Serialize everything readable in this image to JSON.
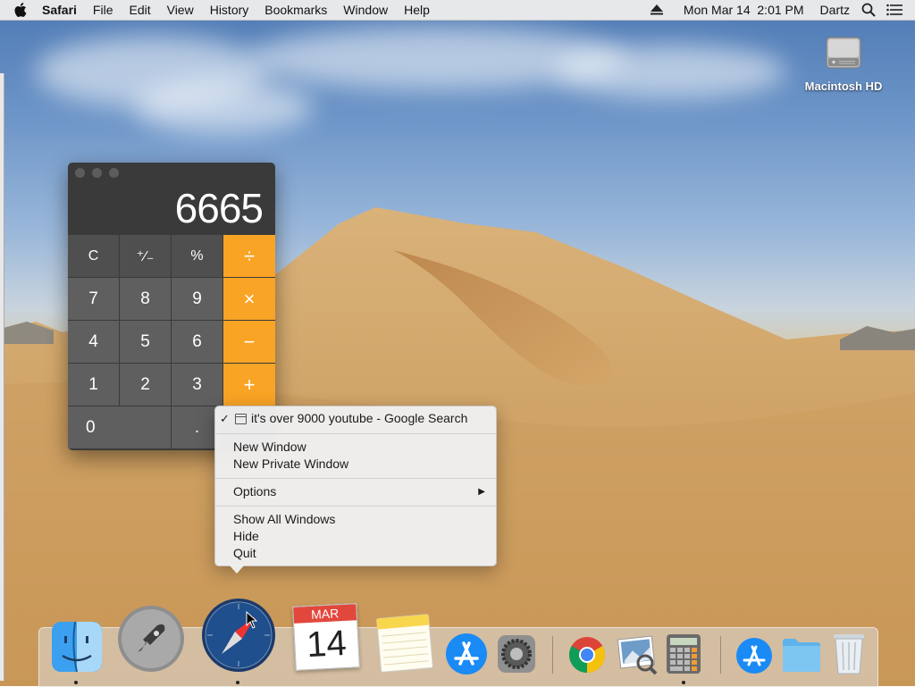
{
  "menubar": {
    "app_name": "Safari",
    "items": [
      "File",
      "Edit",
      "View",
      "History",
      "Bookmarks",
      "Window",
      "Help"
    ],
    "datetime": "Mon Mar 14  2:01 PM",
    "user": "Dartz",
    "icons": [
      "apple-icon",
      "eject-icon",
      "search-icon",
      "list-icon"
    ]
  },
  "desktop": {
    "drive_label": "Macintosh HD"
  },
  "calculator": {
    "display": "6665",
    "keys": [
      {
        "label": "C",
        "kind": "top"
      },
      {
        "label": "⁺∕₋",
        "kind": "top"
      },
      {
        "label": "%",
        "kind": "top"
      },
      {
        "label": "÷",
        "kind": "op"
      },
      {
        "label": "7",
        "kind": "num"
      },
      {
        "label": "8",
        "kind": "num"
      },
      {
        "label": "9",
        "kind": "num"
      },
      {
        "label": "×",
        "kind": "op"
      },
      {
        "label": "4",
        "kind": "num"
      },
      {
        "label": "5",
        "kind": "num"
      },
      {
        "label": "6",
        "kind": "num"
      },
      {
        "label": "−",
        "kind": "op"
      },
      {
        "label": "1",
        "kind": "num"
      },
      {
        "label": "2",
        "kind": "num"
      },
      {
        "label": "3",
        "kind": "num"
      },
      {
        "label": "+",
        "kind": "op"
      },
      {
        "label": "0",
        "kind": "zero"
      },
      {
        "label": ".",
        "kind": "num"
      },
      {
        "label": "",
        "kind": "hidden"
      }
    ]
  },
  "context_menu": {
    "window_item": "it's over 9000 youtube - Google Search",
    "check_mark": "✓",
    "new_window": "New Window",
    "new_private_window": "New Private Window",
    "options": "Options",
    "show_all_windows": "Show All Windows",
    "hide": "Hide",
    "quit": "Quit"
  },
  "dock": {
    "calendar_month": "MAR",
    "calendar_day": "14",
    "apps": [
      "finder-icon",
      "launchpad-icon",
      "safari-icon",
      "calendar-icon",
      "notes-icon",
      "app-store-icon",
      "system-preferences-icon",
      "chrome-icon",
      "preview-icon",
      "calculator-icon",
      "applications-folder-icon",
      "downloads-folder-icon",
      "trash-icon"
    ]
  }
}
